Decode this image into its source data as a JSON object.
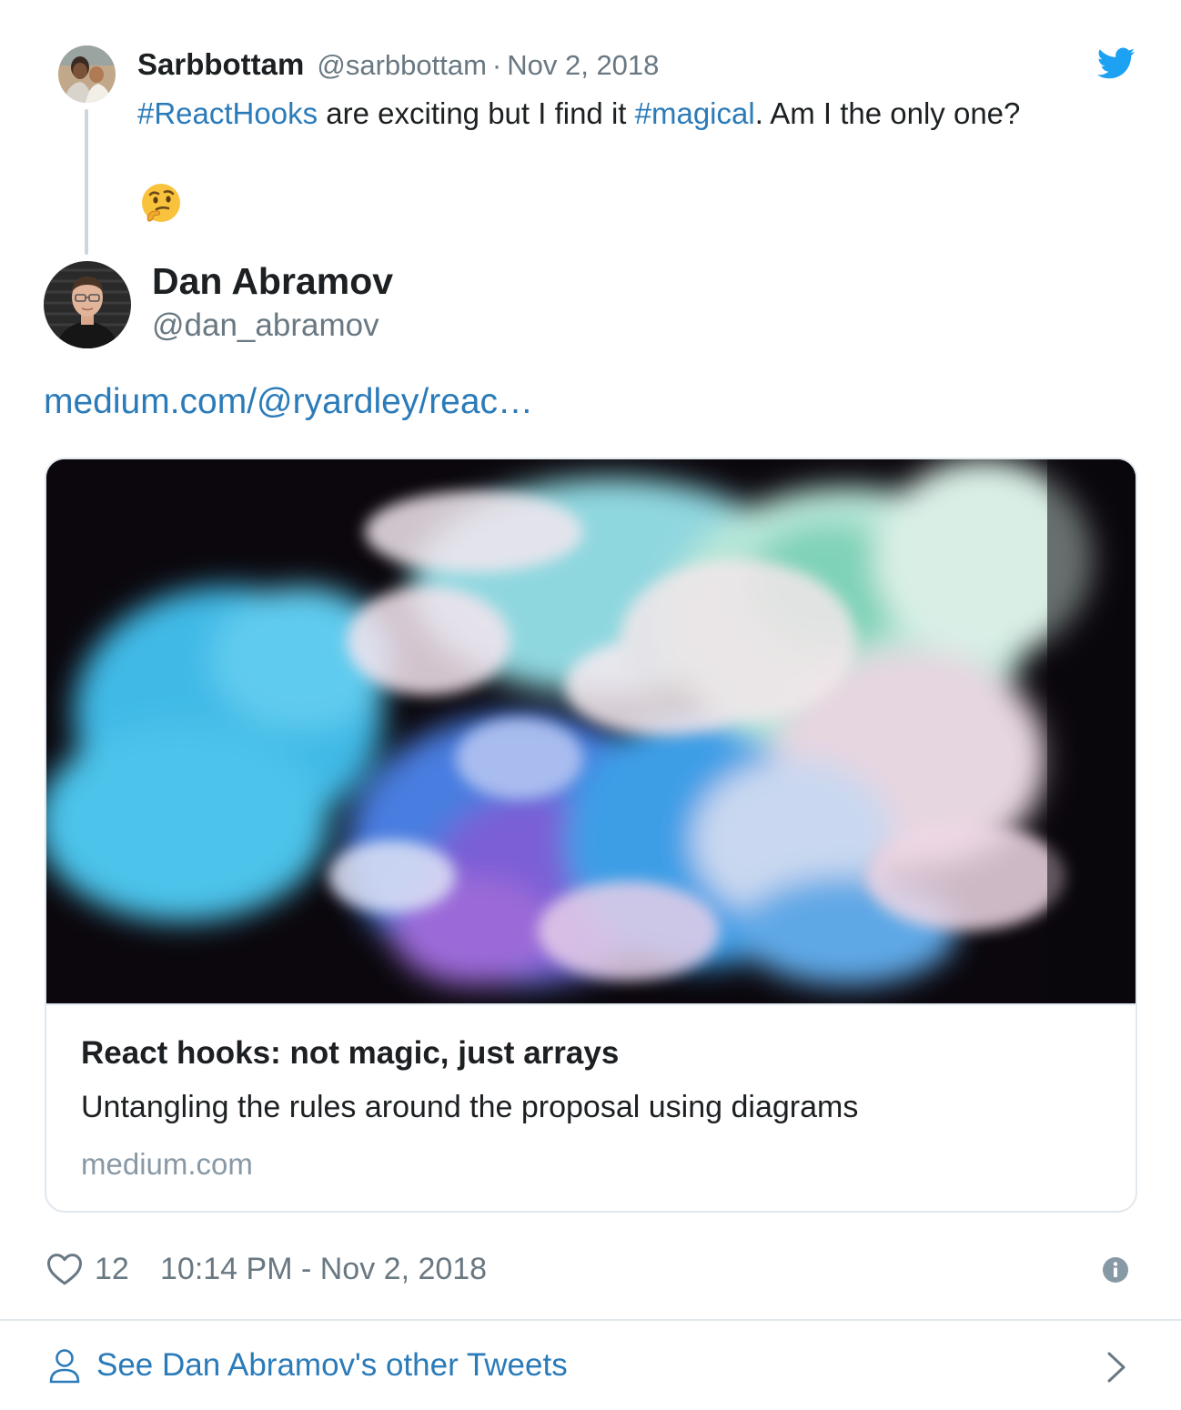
{
  "parent_tweet": {
    "name": "Sarbbottam",
    "handle": "@sarbbottam",
    "separator": "·",
    "date": "Nov 2, 2018",
    "text_parts": [
      "#ReactHooks",
      " are exciting but I find it ",
      "#magical",
      ". Am I the only one?"
    ],
    "emoji": "thinking-face"
  },
  "tweet": {
    "name": "Dan Abramov",
    "handle": "@dan_abramov",
    "link": "medium.com/@ryardley/reac…"
  },
  "card": {
    "title": "React hooks: not magic, just arrays",
    "description": "Untangling the rules around the proposal using diagrams",
    "domain": "medium.com"
  },
  "footer": {
    "like_count": "12",
    "timestamp": "10:14 PM - Nov 2, 2018",
    "see_more": "See Dan Abramov's other Tweets"
  },
  "icons": {
    "brand": "twitter-bird-icon",
    "like": "heart-icon",
    "info": "info-icon",
    "profile": "person-icon",
    "more": "chevron-right-icon"
  },
  "colors": {
    "link": "#2b7bb9",
    "twitter_blue": "#1da1f2",
    "secondary_text": "#697882",
    "border": "#e1e8ed"
  }
}
